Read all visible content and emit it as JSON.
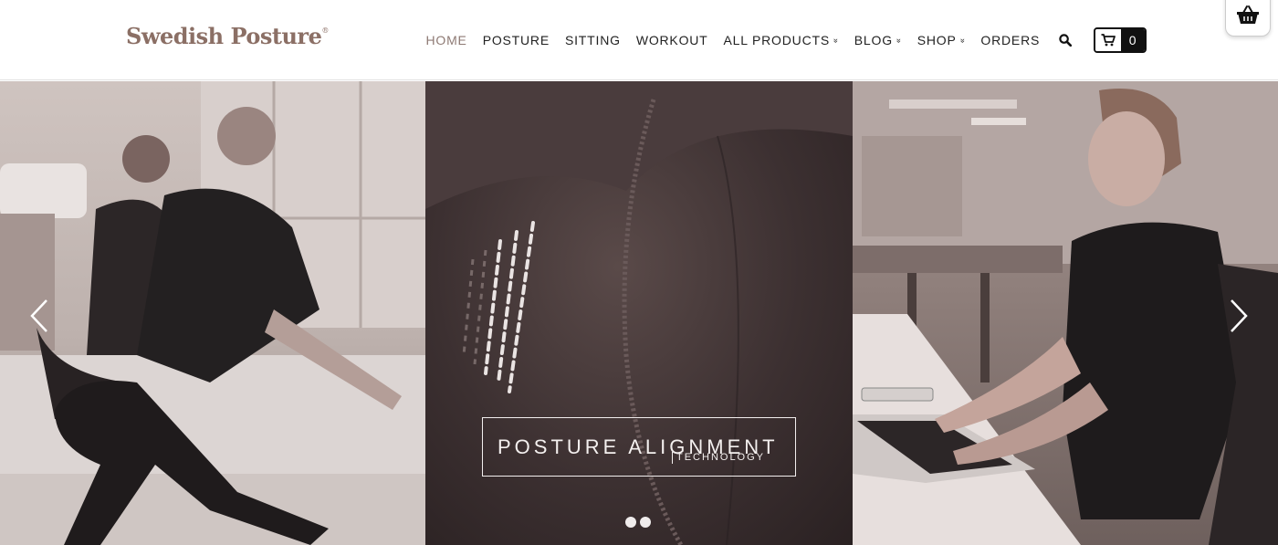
{
  "header": {
    "logo_text": "Swedish Posture",
    "logo_mark": "®",
    "nav": [
      {
        "label": "HOME",
        "active": true,
        "dropdown": false
      },
      {
        "label": "POSTURE",
        "active": false,
        "dropdown": false
      },
      {
        "label": "SITTING",
        "active": false,
        "dropdown": false
      },
      {
        "label": "WORKOUT",
        "active": false,
        "dropdown": false
      },
      {
        "label": "ALL PRODUCTS",
        "active": false,
        "dropdown": true
      },
      {
        "label": "BLOG",
        "active": false,
        "dropdown": true
      },
      {
        "label": "SHOP",
        "active": false,
        "dropdown": true
      },
      {
        "label": "ORDERS",
        "active": false,
        "dropdown": false
      }
    ],
    "dropdown_glyph": "»",
    "search_icon": "search-icon",
    "cart": {
      "icon": "cart-icon",
      "count": "0"
    },
    "basket_icon": "basket-icon"
  },
  "hero": {
    "slides": [
      "workout-squat-photo",
      "posture-shirt-closeup-photo",
      "office-desk-photo"
    ],
    "caption": {
      "main": "POSTURE ALIGNMENT",
      "sub": "TECHNOLOGY"
    },
    "dots_count": 2,
    "prev_icon": "chevron-left-icon",
    "next_icon": "chevron-right-icon"
  },
  "colors": {
    "accent": "#8b6f65",
    "active_nav": "#8e7a74",
    "text": "#222222",
    "caption": "#f4f0ef"
  }
}
